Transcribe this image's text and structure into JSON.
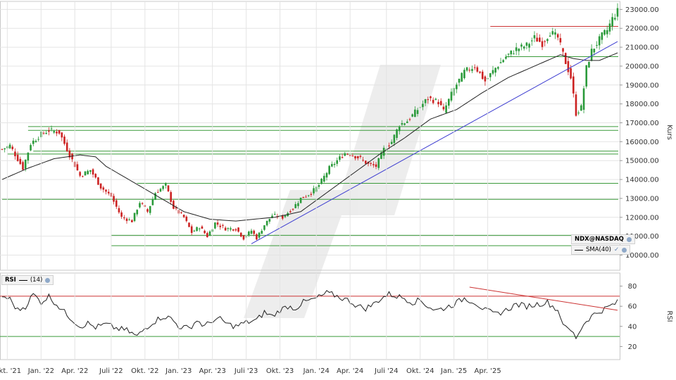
{
  "chart_data": [
    {
      "type": "candlestick",
      "instrument": "NDX@NASDAQ",
      "overlay": "SMA(40)",
      "ylabel": "Kurs",
      "ylim": [
        9200,
        23200
      ],
      "y_ticks": [
        "23000.00",
        "22000.00",
        "21000.00",
        "20000.00",
        "19000.00",
        "18000.00",
        "17000.00",
        "16000.00",
        "15000.00",
        "14000.00",
        "13000.00",
        "12000.00",
        "11000.00",
        "10000.00"
      ],
      "x_ticks": [
        "Okt. '21",
        "Jan. '22",
        "Apr. '22",
        "Juli '22",
        "Okt. '22",
        "Jan. '23",
        "Apr. '23",
        "Juli '23",
        "Okt. '23",
        "Jan. '24",
        "Apr. '24",
        "Juli '24",
        "Okt. '24",
        "Jan. '25",
        "Apr. '25"
      ],
      "series": [
        {
          "name": "NDX@NASDAQ",
          "weekly_close_keypoints": [
            [
              0,
              15600
            ],
            [
              3,
              15800
            ],
            [
              8,
              14600
            ],
            [
              11,
              15900
            ],
            [
              15,
              16400
            ],
            [
              18,
              16600
            ],
            [
              22,
              16500
            ],
            [
              26,
              15300
            ],
            [
              30,
              14200
            ],
            [
              34,
              14500
            ],
            [
              38,
              13600
            ],
            [
              42,
              13100
            ],
            [
              46,
              12000
            ],
            [
              50,
              11800
            ],
            [
              53,
              12800
            ],
            [
              56,
              12300
            ],
            [
              59,
              13300
            ],
            [
              63,
              13700
            ],
            [
              66,
              12500
            ],
            [
              70,
              12000
            ],
            [
              73,
              11200
            ],
            [
              76,
              11500
            ],
            [
              79,
              11000
            ],
            [
              82,
              11700
            ],
            [
              86,
              11400
            ],
            [
              90,
              11400
            ],
            [
              93,
              10900
            ],
            [
              96,
              11300
            ],
            [
              98,
              10900
            ],
            [
              101,
              11600
            ],
            [
              104,
              12100
            ],
            [
              108,
              12000
            ],
            [
              112,
              12500
            ],
            [
              115,
              13000
            ],
            [
              119,
              13300
            ],
            [
              122,
              13700
            ],
            [
              126,
              14600
            ],
            [
              129,
              15000
            ],
            [
              132,
              15400
            ],
            [
              135,
              15300
            ],
            [
              138,
              15100
            ],
            [
              141,
              14800
            ],
            [
              144,
              14700
            ],
            [
              147,
              15600
            ],
            [
              150,
              16000
            ],
            [
              153,
              16900
            ],
            [
              156,
              17100
            ],
            [
              160,
              17700
            ],
            [
              164,
              18300
            ],
            [
              168,
              18100
            ],
            [
              170,
              17600
            ],
            [
              174,
              18800
            ],
            [
              178,
              19700
            ],
            [
              182,
              20000
            ],
            [
              186,
              19200
            ],
            [
              190,
              19900
            ],
            [
              194,
              20500
            ],
            [
              198,
              20900
            ],
            [
              202,
              21100
            ],
            [
              205,
              21500
            ],
            [
              208,
              21200
            ],
            [
              211,
              21800
            ],
            [
              214,
              21500
            ],
            [
              217,
              20200
            ],
            [
              219,
              19400
            ],
            [
              221,
              17500
            ],
            [
              223,
              17800
            ],
            [
              225,
              19900
            ],
            [
              227,
              20800
            ],
            [
              229,
              21200
            ],
            [
              231,
              21600
            ],
            [
              233,
              21900
            ],
            [
              235,
              22500
            ],
            [
              237,
              22900
            ]
          ]
        },
        {
          "name": "SMA(40)",
          "keypoints": [
            [
              0,
              14000
            ],
            [
              10,
              14600
            ],
            [
              20,
              15100
            ],
            [
              30,
              15300
            ],
            [
              36,
              15200
            ],
            [
              40,
              14700
            ],
            [
              50,
              13900
            ],
            [
              60,
              13100
            ],
            [
              70,
              12300
            ],
            [
              80,
              11900
            ],
            [
              90,
              11800
            ],
            [
              97,
              11900
            ],
            [
              105,
              12000
            ],
            [
              115,
              12300
            ],
            [
              125,
              13300
            ],
            [
              135,
              14300
            ],
            [
              145,
              15300
            ],
            [
              155,
              16200
            ],
            [
              165,
              17200
            ],
            [
              175,
              17700
            ],
            [
              185,
              18600
            ],
            [
              195,
              19400
            ],
            [
              205,
              20000
            ],
            [
              215,
              20600
            ],
            [
              220,
              20400
            ],
            [
              225,
              20300
            ],
            [
              230,
              20300
            ],
            [
              237,
              20700
            ]
          ]
        }
      ],
      "support_resistance_levels": [
        22100,
        20500,
        16800,
        16600,
        15500,
        15350,
        13800,
        12950,
        11050,
        10500
      ],
      "trendline": {
        "from": [
          96,
          10600
        ],
        "to": [
          237,
          21300
        ]
      }
    },
    {
      "type": "line",
      "indicator": "RSI",
      "period_label": "(14)",
      "ylabel": "RSI",
      "ylim": [
        7,
        93
      ],
      "y_ticks": [
        "80",
        "60",
        "40",
        "20"
      ],
      "levels": [
        70,
        30
      ],
      "keypoints": [
        [
          0,
          70
        ],
        [
          3,
          67
        ],
        [
          6,
          56
        ],
        [
          9,
          60
        ],
        [
          12,
          72
        ],
        [
          15,
          64
        ],
        [
          18,
          70
        ],
        [
          21,
          62
        ],
        [
          24,
          54
        ],
        [
          27,
          47
        ],
        [
          30,
          40
        ],
        [
          33,
          43
        ],
        [
          36,
          39
        ],
        [
          40,
          42
        ],
        [
          44,
          38
        ],
        [
          48,
          36
        ],
        [
          52,
          30
        ],
        [
          55,
          38
        ],
        [
          58,
          44
        ],
        [
          62,
          50
        ],
        [
          65,
          48
        ],
        [
          68,
          40
        ],
        [
          72,
          38
        ],
        [
          75,
          46
        ],
        [
          78,
          40
        ],
        [
          81,
          46
        ],
        [
          84,
          47
        ],
        [
          87,
          42
        ],
        [
          90,
          40
        ],
        [
          94,
          44
        ],
        [
          98,
          46
        ],
        [
          101,
          54
        ],
        [
          104,
          50
        ],
        [
          107,
          56
        ],
        [
          110,
          60
        ],
        [
          113,
          58
        ],
        [
          116,
          64
        ],
        [
          119,
          66
        ],
        [
          122,
          69
        ],
        [
          125,
          73
        ],
        [
          128,
          71
        ],
        [
          131,
          68
        ],
        [
          134,
          65
        ],
        [
          137,
          60
        ],
        [
          140,
          58
        ],
        [
          143,
          62
        ],
        [
          146,
          68
        ],
        [
          149,
          72
        ],
        [
          152,
          70
        ],
        [
          155,
          68
        ],
        [
          158,
          64
        ],
        [
          161,
          66
        ],
        [
          164,
          60
        ],
        [
          167,
          56
        ],
        [
          170,
          58
        ],
        [
          174,
          62
        ],
        [
          178,
          68
        ],
        [
          182,
          64
        ],
        [
          186,
          56
        ],
        [
          190,
          52
        ],
        [
          194,
          56
        ],
        [
          198,
          62
        ],
        [
          202,
          60
        ],
        [
          206,
          62
        ],
        [
          210,
          64
        ],
        [
          214,
          56
        ],
        [
          217,
          38
        ],
        [
          219,
          36
        ],
        [
          221,
          29
        ],
        [
          223,
          38
        ],
        [
          225,
          46
        ],
        [
          228,
          52
        ],
        [
          231,
          56
        ],
        [
          234,
          60
        ],
        [
          237,
          64
        ]
      ],
      "trendline": {
        "from": [
          180,
          79
        ],
        "to": [
          237,
          56
        ]
      }
    }
  ],
  "legends": {
    "price_symbol": "NDX@NASDAQ",
    "sma_label": "SMA(40)",
    "rsi_label": "RSI",
    "rsi_period": "(14)"
  },
  "colors": {
    "up": "#2a9a3a",
    "down": "#cc2222",
    "sma": "#222222",
    "trendline": "#3b3bd0",
    "support": "#3a9a3a",
    "resistance": "#cc3333",
    "rsi_line": "#222222"
  }
}
